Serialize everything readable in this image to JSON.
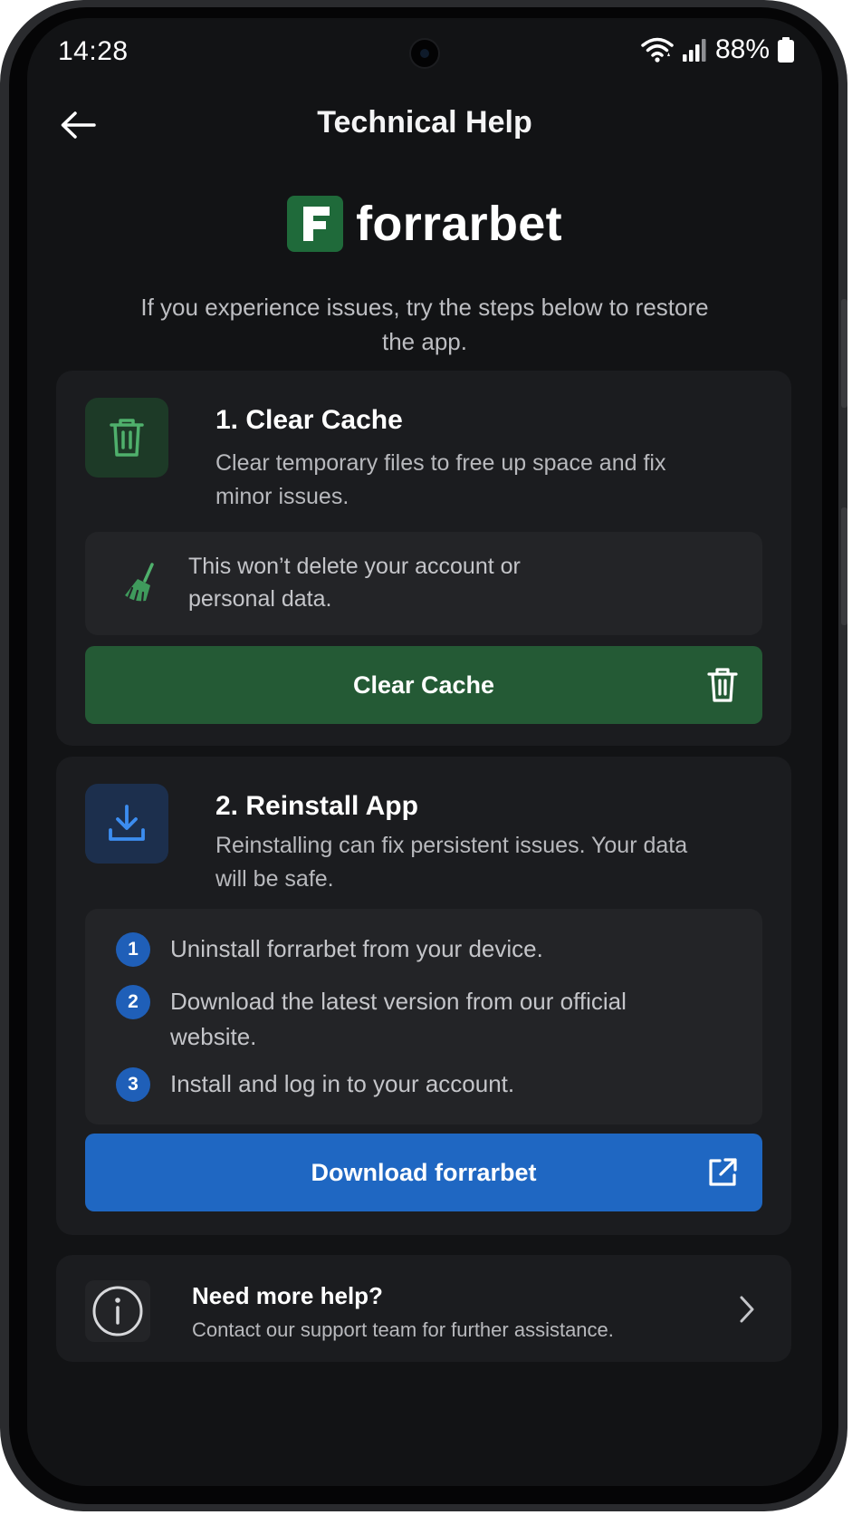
{
  "status_bar": {
    "time": "14:28",
    "battery_percent": "88%",
    "icons": [
      "wifi-icon",
      "signal-icon",
      "battery-icon"
    ]
  },
  "header": {
    "title": "Technical Help",
    "back_icon": "arrow-left-icon"
  },
  "brand": {
    "name": "forrarbet",
    "mark_letter": "F",
    "color": "#1f6a3a"
  },
  "intro": "If you experience issues, try the steps below to restore the app.",
  "clear_cache": {
    "title": "1. Clear Cache",
    "description": "Clear temporary files to free up space and fix minor issues.",
    "note": "This won’t delete your account or personal data.",
    "button_label": "Clear Cache",
    "icon": "trash-icon",
    "note_icon": "broom-icon",
    "accent": "#2f8a4d"
  },
  "reinstall": {
    "title": "2. Reinstall App",
    "description": "Reinstalling can fix persistent issues. Your data will be safe.",
    "steps": [
      {
        "num": "1",
        "text": "Uninstall forrarbet from your device."
      },
      {
        "num": "2",
        "text": "Download the latest version from our official website."
      },
      {
        "num": "3",
        "text": "Install and log in to your account."
      }
    ],
    "button_label": "Download forrarbet",
    "icon": "download-icon",
    "button_icon": "external-link-icon",
    "accent": "#1f67c2"
  },
  "help": {
    "title": "Need more help?",
    "description": "Contact our support team for further assistance.",
    "icon": "info-icon"
  }
}
